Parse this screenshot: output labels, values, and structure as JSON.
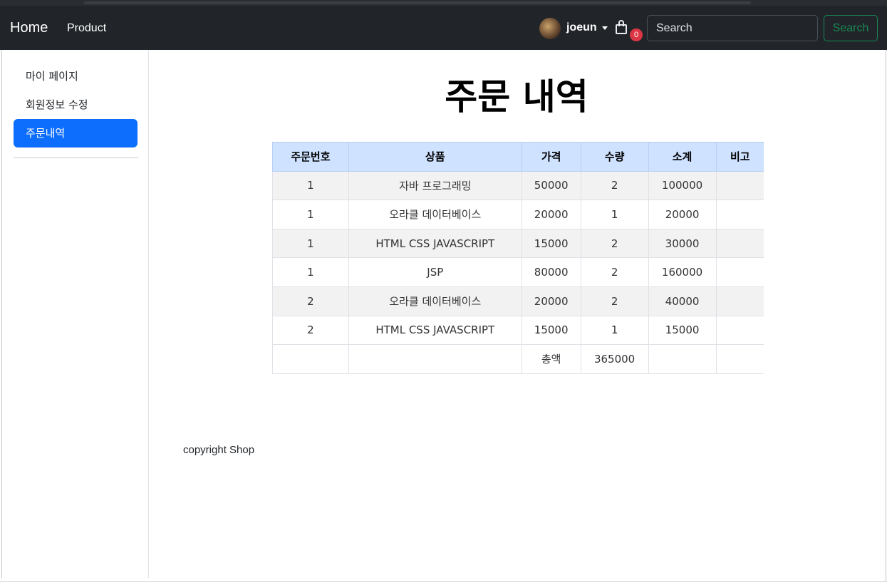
{
  "navbar": {
    "brand": "Home",
    "product_link": "Product",
    "user_name": "joeun",
    "cart_count": "0",
    "search_placeholder": "Search",
    "search_button": "Search"
  },
  "sidebar": {
    "items": [
      {
        "label": "마이 페이지",
        "active": false
      },
      {
        "label": "회원정보 수정",
        "active": false
      },
      {
        "label": "주문내역",
        "active": true
      }
    ]
  },
  "main": {
    "title": "주문 내역",
    "table": {
      "headers": [
        "주문번호",
        "상품",
        "가격",
        "수량",
        "소계",
        "비고"
      ],
      "rows": [
        [
          "1",
          "자바 프로그래밍",
          "50000",
          "2",
          "100000",
          ""
        ],
        [
          "1",
          "오라클 데이터베이스",
          "20000",
          "1",
          "20000",
          ""
        ],
        [
          "1",
          "HTML CSS JAVASCRIPT",
          "15000",
          "2",
          "30000",
          ""
        ],
        [
          "1",
          "JSP",
          "80000",
          "2",
          "160000",
          ""
        ],
        [
          "2",
          "오라클 데이터베이스",
          "20000",
          "2",
          "40000",
          ""
        ],
        [
          "2",
          "HTML CSS JAVASCRIPT",
          "15000",
          "1",
          "15000",
          ""
        ]
      ],
      "total_label": "총액",
      "total_value": "365000"
    }
  },
  "footer": {
    "copyright": "copyright Shop"
  },
  "colors": {
    "navbar_bg": "#212529",
    "active_item": "#0d6efd",
    "table_header_bg": "#cfe2ff",
    "cart_badge": "#dc3545",
    "search_button": "#198754"
  }
}
